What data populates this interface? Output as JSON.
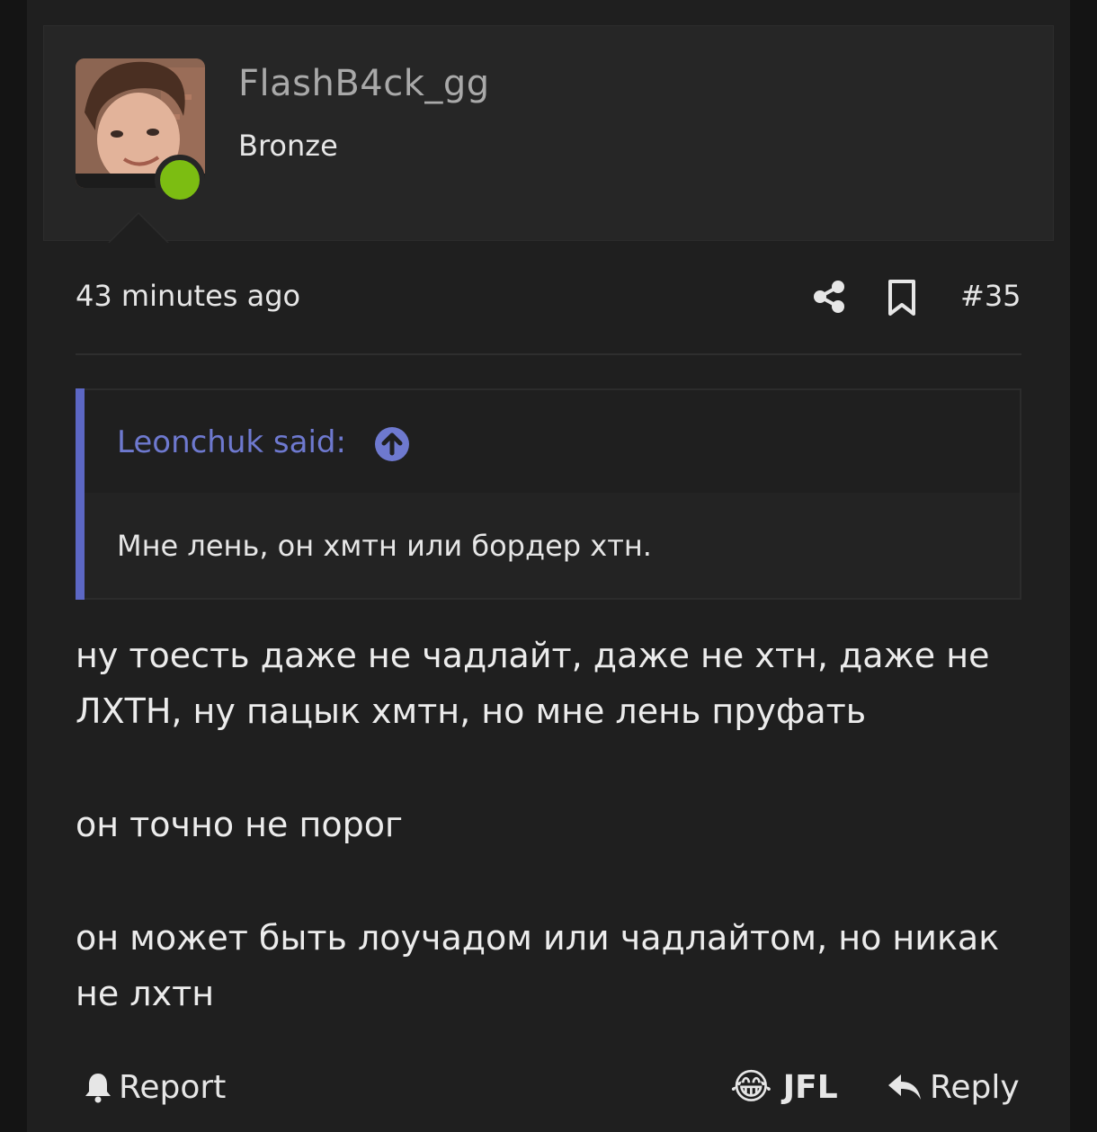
{
  "user": {
    "username": "FlashB4ck_gg",
    "rank": "Bronze",
    "online_status_color": "#7cbd12",
    "avatar_icon": "user-avatar-photo"
  },
  "post": {
    "time": "43 minutes ago",
    "number": "#35",
    "share_icon": "share-icon",
    "bookmark_icon": "bookmark-icon"
  },
  "quote": {
    "author_line": "Leonchuk said:",
    "jump_icon": "arrow-up-circle-icon",
    "text": "Мне лень, он хмтн или бордер хтн.",
    "accent_color": "#5c67c4"
  },
  "body": {
    "paragraphs": [
      "ну тоесть даже не чадлайт, даже не хтн, даже не ЛХТН, ну пацык хмтн, но мне лень пруфать",
      "он точно не порог",
      "он может быть лоучадом или чадлайтом, но никак не лхтн"
    ]
  },
  "actions": {
    "report_label": "Report",
    "reaction_emoji": "😂",
    "reaction_label": "JFL",
    "reply_label": "Reply"
  }
}
